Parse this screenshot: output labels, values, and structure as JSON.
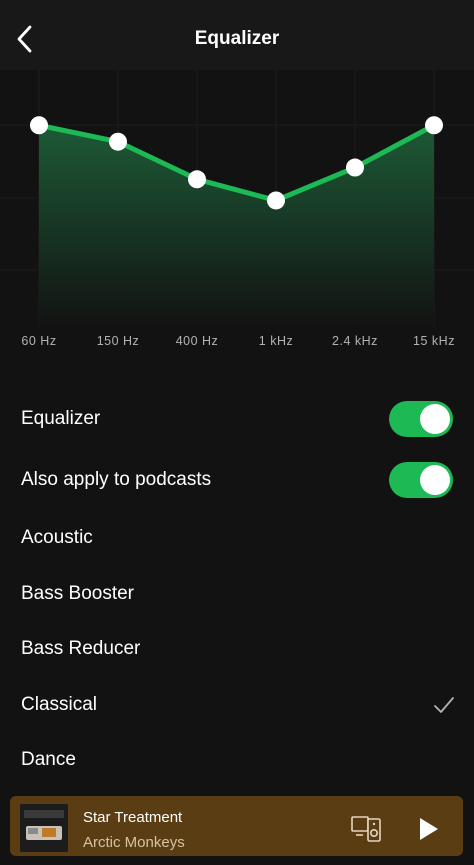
{
  "header": {
    "title": "Equalizer",
    "back_icon": "chevron-left-icon"
  },
  "equalizer": {
    "bands": [
      {
        "label": "60 Hz",
        "level": 0.85
      },
      {
        "label": "150 Hz",
        "level": 0.78
      },
      {
        "label": "400 Hz",
        "level": 0.62
      },
      {
        "label": "1 kHz",
        "level": 0.53
      },
      {
        "label": "2.4 kHz",
        "level": 0.67
      },
      {
        "label": "15 kHz",
        "level": 0.85
      }
    ],
    "accent_color": "#1db954"
  },
  "settings": {
    "equalizer_toggle": {
      "label": "Equalizer",
      "on": true
    },
    "podcasts_toggle": {
      "label": "Also apply to podcasts",
      "on": true
    }
  },
  "presets": [
    {
      "label": "Acoustic",
      "selected": false
    },
    {
      "label": "Bass Booster",
      "selected": false
    },
    {
      "label": "Bass Reducer",
      "selected": false
    },
    {
      "label": "Classical",
      "selected": true
    },
    {
      "label": "Dance",
      "selected": false
    }
  ],
  "now_playing": {
    "title": "Star Treatment",
    "artist": "Arctic Monkeys",
    "background": "#5a3d13",
    "devices_icon": "connect-devices-icon",
    "play_icon": "play-icon"
  }
}
